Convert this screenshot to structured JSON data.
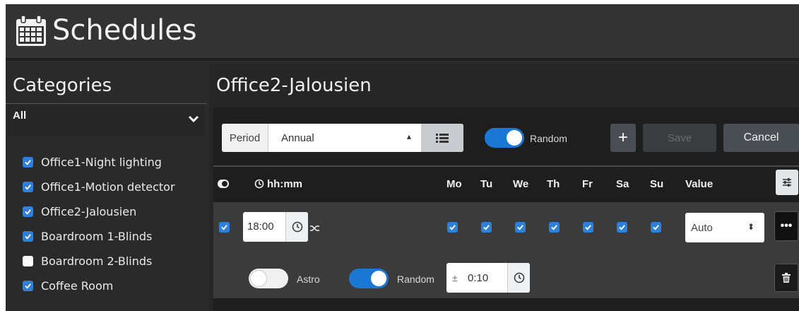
{
  "header": {
    "title": "Schedules",
    "icon": "calendar-icon"
  },
  "categories": {
    "title": "Categories",
    "filter_selected": "All",
    "items": [
      {
        "label": "Office1-Night lighting",
        "checked": true
      },
      {
        "label": "Office1-Motion detector",
        "checked": true
      },
      {
        "label": "Office2-Jalousien",
        "checked": true
      },
      {
        "label": "Boardroom 1-Blinds",
        "checked": true
      },
      {
        "label": "Boardroom 2-Blinds",
        "checked": false
      },
      {
        "label": "Coffee Room",
        "checked": true
      }
    ]
  },
  "main": {
    "title": "Office2-Jalousien",
    "toolbar": {
      "period_label": "Period",
      "period_value": "Annual",
      "random_label": "Random",
      "random_on": true,
      "add_label": "+",
      "save_label": "Save",
      "cancel_label": "Cancel"
    },
    "table": {
      "headers": {
        "time": "hh:mm",
        "days": [
          "Mo",
          "Tu",
          "We",
          "Th",
          "Fr",
          "Sa",
          "Su"
        ],
        "value": "Value"
      },
      "rows": [
        {
          "enabled": true,
          "time": "18:00",
          "days": [
            true,
            true,
            true,
            true,
            true,
            true,
            true
          ],
          "value": "Auto",
          "more_label": "•••",
          "astro_label": "Astro",
          "astro_on": false,
          "random_label": "Random",
          "random_on": true,
          "offset_prefix": "±",
          "offset_value": "0:10"
        }
      ]
    }
  },
  "colors": {
    "accent": "#1a78d4",
    "checkbox": "#2f80d6",
    "panel": "#2b2b2b"
  }
}
